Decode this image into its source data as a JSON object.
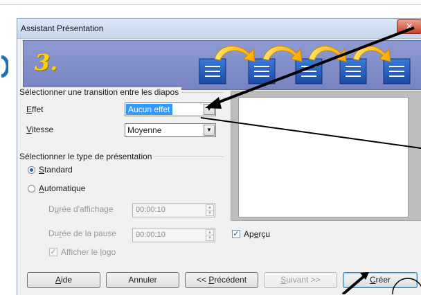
{
  "window": {
    "title": "Assistant Présentation",
    "close_glyph": "✕"
  },
  "banner": {
    "step": "3."
  },
  "transition": {
    "group_label": "Sélectionner une transition entre les diapos",
    "effect_label_ul": "E",
    "effect_label_rest": "ffet",
    "effect_value": "Aucun effet",
    "speed_label_ul": "V",
    "speed_label_rest": "itesse",
    "speed_value": "Moyenne"
  },
  "presentation_type": {
    "group_label": "Sélectionner le type de présentation",
    "standard_ul": "S",
    "standard_rest": "tandard",
    "auto_ul": "A",
    "auto_rest": "utomatique",
    "display_duration_pre": "D",
    "display_duration_ul": "u",
    "display_duration_rest": "rée d'affichage",
    "display_duration_value": "00:00:10",
    "pause_duration_pre": "Du",
    "pause_duration_ul": "r",
    "pause_duration_rest": "ée de la pause",
    "pause_duration_value": "00:00:10",
    "show_logo_pre": "Afficher le ",
    "show_logo_ul": "l",
    "show_logo_rest": "ogo",
    "selected": "standard"
  },
  "preview": {
    "label_pre": "Ap",
    "label_ul": "e",
    "label_rest": "rçu",
    "checked": true
  },
  "buttons": {
    "help_ul": "A",
    "help_rest": "ide",
    "cancel": "Annuler",
    "prev_pre": "<< ",
    "prev_ul": "P",
    "prev_rest": "récédent",
    "next_ul": "S",
    "next_rest": "uivant >>",
    "create_ul": "C",
    "create_rest": "réer"
  },
  "icons": {
    "close": "close-icon",
    "dropdown": "chevron-down-icon",
    "check": "checkmark-icon",
    "spin_up": "triangle-up-icon",
    "spin_down": "triangle-down-icon"
  },
  "colors": {
    "selection": "#3399ff",
    "banner": "#7f8bc7",
    "step_number": "#ffd200",
    "arrow": "#ffb400"
  }
}
